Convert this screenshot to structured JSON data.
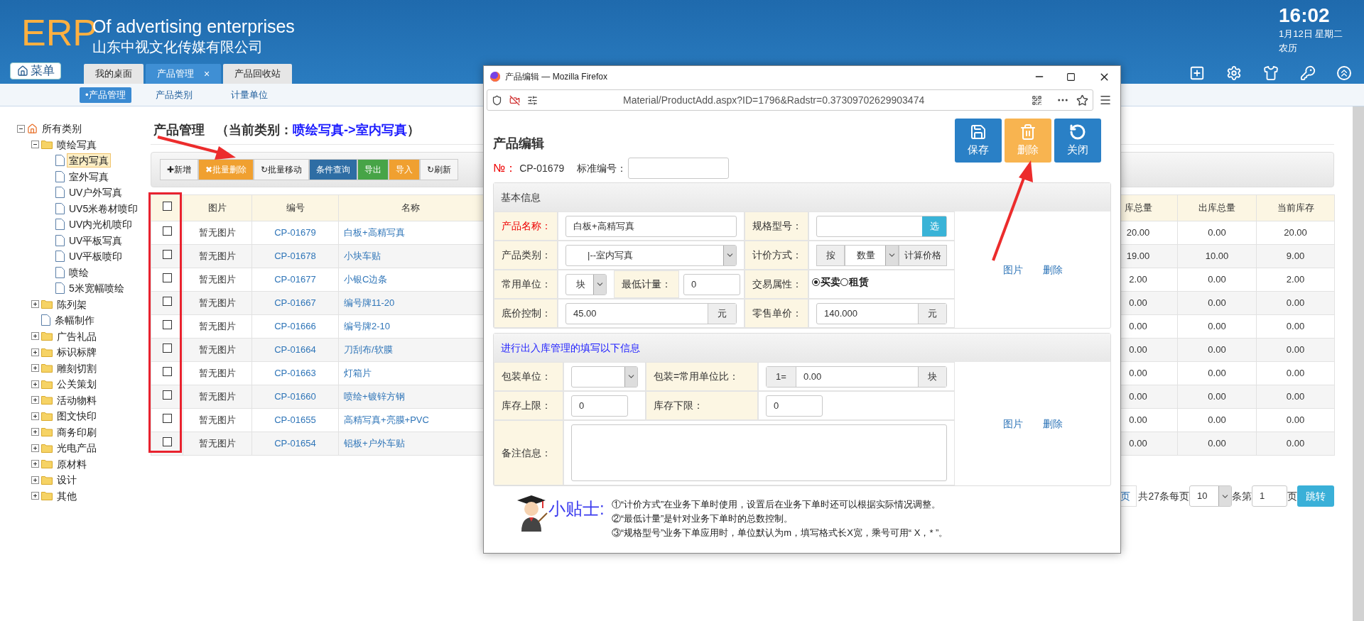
{
  "header": {
    "logo": "ERP",
    "title": "Of advertising enterprises",
    "company": "山东中视文化传媒有限公司",
    "time": "16:02",
    "date": "1月12日 星期二",
    "lunar": "农历"
  },
  "menu_button": "菜单",
  "tabs": [
    {
      "label": "我的桌面",
      "selected": false
    },
    {
      "label": "产品管理",
      "selected": true,
      "close": "×"
    },
    {
      "label": "产品回收站",
      "selected": false
    }
  ],
  "subnav": [
    {
      "label": "•产品管理",
      "selected": true
    },
    {
      "label": "产品类别",
      "selected": false
    },
    {
      "label": "计量单位",
      "selected": false
    }
  ],
  "tree": {
    "label": "所有类别",
    "kind": "root",
    "expanded": true,
    "selected": false,
    "children": [
      {
        "label": "喷绘写真",
        "kind": "folder",
        "expanded": true,
        "selected": false,
        "children": [
          {
            "label": "室内写真",
            "kind": "file",
            "selected": true
          },
          {
            "label": "室外写真",
            "kind": "file",
            "selected": false
          },
          {
            "label": "UV户外写真",
            "kind": "file",
            "selected": false
          },
          {
            "label": "UV5米卷材喷印",
            "kind": "file",
            "selected": false
          },
          {
            "label": "UV内光机喷印",
            "kind": "file",
            "selected": false
          },
          {
            "label": "UV平板写真",
            "kind": "file",
            "selected": false
          },
          {
            "label": "UV平板喷印",
            "kind": "file",
            "selected": false
          },
          {
            "label": "喷绘",
            "kind": "file",
            "selected": false
          },
          {
            "label": "5米宽幅喷绘",
            "kind": "file",
            "selected": false
          }
        ]
      },
      {
        "label": "陈列架",
        "kind": "folder",
        "expanded": false,
        "selected": false
      },
      {
        "label": "条幅制作",
        "kind": "file",
        "selected": false
      },
      {
        "label": "广告礼品",
        "kind": "folder",
        "expanded": false,
        "selected": false
      },
      {
        "label": "标识标牌",
        "kind": "folder",
        "expanded": false,
        "selected": false
      },
      {
        "label": "雕刻切割",
        "kind": "folder",
        "expanded": false,
        "selected": false
      },
      {
        "label": "公关策划",
        "kind": "folder",
        "expanded": false,
        "selected": false
      },
      {
        "label": "活动物料",
        "kind": "folder",
        "expanded": false,
        "selected": false
      },
      {
        "label": "图文快印",
        "kind": "folder",
        "expanded": false,
        "selected": false
      },
      {
        "label": "商务印刷",
        "kind": "folder",
        "expanded": false,
        "selected": false
      },
      {
        "label": "光电产品",
        "kind": "folder",
        "expanded": false,
        "selected": false
      },
      {
        "label": "原材料",
        "kind": "folder",
        "expanded": false,
        "selected": false
      },
      {
        "label": "设计",
        "kind": "folder",
        "expanded": false,
        "selected": false
      },
      {
        "label": "其他",
        "kind": "folder",
        "expanded": false,
        "selected": false
      }
    ]
  },
  "page_title": {
    "label": "产品管理",
    "prefix": "（当前类别：",
    "category": "喷绘写真->室内写真",
    "suffix": "）"
  },
  "toolbar": [
    {
      "label": "✚新增",
      "color": "#f5f5f5"
    },
    {
      "label": "✖批量删除",
      "color": "#f0a030"
    },
    {
      "label": "↻批量移动",
      "color": "#f5f5f5"
    },
    {
      "label": "条件查询",
      "color": "#2e6da4"
    },
    {
      "label": "导出",
      "color": "#47a447"
    },
    {
      "label": "导入",
      "color": "#f0a030"
    },
    {
      "label": "↻刷新",
      "color": "#f5f5f5"
    }
  ],
  "table": {
    "select_all_checked": false,
    "columns": [
      "图片",
      "编号",
      "名称",
      "库总量",
      "出库总量",
      "当前库存"
    ],
    "rows": [
      {
        "checked": false,
        "picture": "暂无图片",
        "code": "CP-01679",
        "name": "白板+高精写真",
        "in_total": "20.00",
        "out_total": "0.00",
        "stock": "20.00"
      },
      {
        "checked": false,
        "picture": "暂无图片",
        "code": "CP-01678",
        "name": "小块车贴",
        "in_total": "19.00",
        "out_total": "10.00",
        "stock": "9.00"
      },
      {
        "checked": false,
        "picture": "暂无图片",
        "code": "CP-01677",
        "name": "小银C边条",
        "in_total": "2.00",
        "out_total": "0.00",
        "stock": "2.00"
      },
      {
        "checked": false,
        "picture": "暂无图片",
        "code": "CP-01667",
        "name": "编号牌11-20",
        "in_total": "0.00",
        "out_total": "0.00",
        "stock": "0.00"
      },
      {
        "checked": false,
        "picture": "暂无图片",
        "code": "CP-01666",
        "name": "编号牌2-10",
        "in_total": "0.00",
        "out_total": "0.00",
        "stock": "0.00"
      },
      {
        "checked": false,
        "picture": "暂无图片",
        "code": "CP-01664",
        "name": "刀刮布/软膜",
        "in_total": "0.00",
        "out_total": "0.00",
        "stock": "0.00"
      },
      {
        "checked": false,
        "picture": "暂无图片",
        "code": "CP-01663",
        "name": "灯箱片",
        "in_total": "0.00",
        "out_total": "0.00",
        "stock": "0.00"
      },
      {
        "checked": false,
        "picture": "暂无图片",
        "code": "CP-01660",
        "name": "喷绘+镀锌方钢",
        "in_total": "0.00",
        "out_total": "0.00",
        "stock": "0.00"
      },
      {
        "checked": false,
        "picture": "暂无图片",
        "code": "CP-01655",
        "name": "高精写真+亮膜+PVC",
        "in_total": "0.00",
        "out_total": "0.00",
        "stock": "0.00"
      },
      {
        "checked": false,
        "picture": "暂无图片",
        "code": "CP-01654",
        "name": "铝板+户外车贴",
        "in_total": "0.00",
        "out_total": "0.00",
        "stock": "0.00"
      }
    ]
  },
  "pagination": {
    "last_page": "页",
    "total_text": "共27条每页",
    "page_size": "10",
    "items_text": "条第",
    "page": "1",
    "page_text": "页",
    "go": "跳转"
  },
  "modal": {
    "window_title": "产品编辑 — Mozilla Firefox",
    "url": "Material/ProductAdd.aspx?ID=1796&Radstr=0.37309702629903474",
    "heading": "产品编辑",
    "actions": [
      {
        "label": "保存",
        "kind": "save",
        "color": "#2a80c6"
      },
      {
        "label": "删除",
        "kind": "delete",
        "color": "#f8b450"
      },
      {
        "label": "关闭",
        "kind": "close",
        "color": "#2a80c6"
      }
    ],
    "number_label": "№：",
    "number": "CP-01679",
    "std_label": "标准编号：",
    "basic": {
      "title": "基本信息",
      "name_label": "产品名称：",
      "name_required": true,
      "name_value": "白板+高精写真",
      "spec_label": "规格型号：",
      "spec_button": "选",
      "category_label": "产品类别：",
      "category_value": "|--室内写真",
      "pricing_label": "计价方式：",
      "pricing_prefix": "按",
      "pricing_value": "数量",
      "pricing_button": "计算价格",
      "unit_label": "常用单位：",
      "unit_value": "块",
      "min_label": "最低计量：",
      "min_value": "0",
      "trade_label": "交易属性：",
      "trade_options": [
        {
          "label": "买卖",
          "selected": true
        },
        {
          "label": "租赁",
          "selected": false
        }
      ],
      "floor_label": "底价控制：",
      "floor_value": "45.00",
      "floor_unit": "元",
      "retail_label": "零售单价：",
      "retail_value": "140.000",
      "retail_unit": "元",
      "image_link": "图片",
      "delete_link": "删除"
    },
    "stock": {
      "title": "进行出入库管理的填写以下信息",
      "pack_label": "包装单位：",
      "ratio_label": "包装=常用单位比：",
      "ratio_prefix": "1=",
      "ratio_value": "0.00",
      "ratio_unit": "块",
      "max_label": "库存上限：",
      "max_value": "0",
      "min_label": "库存下限：",
      "min_value": "0",
      "note_label": "备注信息：",
      "image_link": "图片",
      "delete_link": "删除"
    },
    "tips": {
      "title": "小贴士:",
      "lines": [
        "①“计价方式”在业务下单时使用，设置后在业务下单时还可以根据实际情况调整。",
        "②“最低计量”是针对业务下单时的总数控制。",
        "③“规格型号”业务下单应用时，单位默认为m，填写格式长X宽，乘号可用“ X，* ”。"
      ]
    }
  }
}
